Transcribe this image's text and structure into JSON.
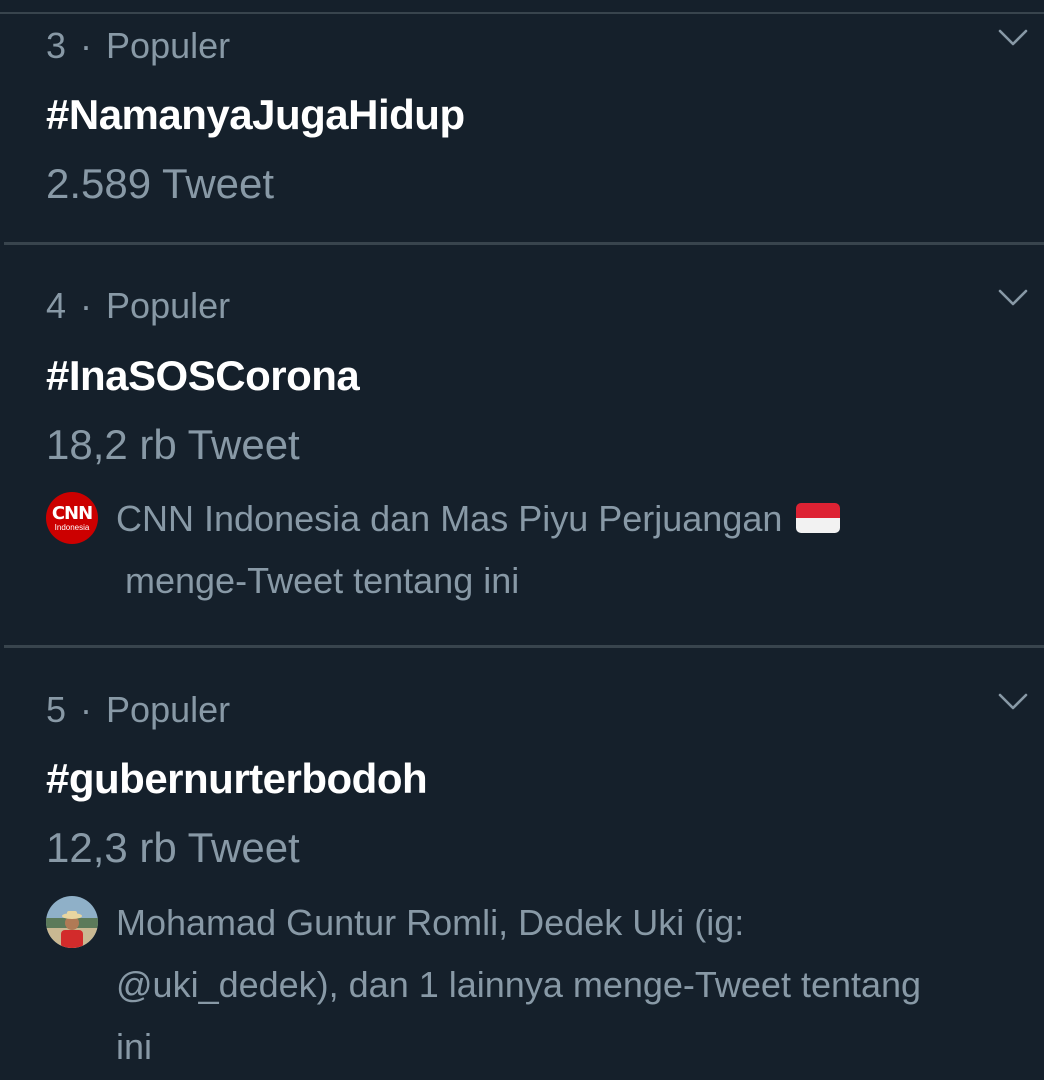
{
  "trends": [
    {
      "rank": "3",
      "separator": "·",
      "category": "Populer",
      "hashtag": "#NamanyaJugaHidup",
      "tweet_count": "2.589 Tweet"
    },
    {
      "rank": "4",
      "separator": "·",
      "category": "Populer",
      "hashtag": "#InaSOSCorona",
      "tweet_count": "18,2 rb Tweet",
      "context": {
        "avatar": "cnn-indonesia-logo",
        "avatar_text": "CNN",
        "avatar_subtext": "Indonesia",
        "line1": "CNN Indonesia dan Mas Piyu Perjuangan",
        "flag": "indonesia-flag-emoji",
        "line2": "menge-Tweet tentang ini"
      }
    },
    {
      "rank": "5",
      "separator": "·",
      "category": "Populer",
      "hashtag": "#gubernurterbodoh",
      "tweet_count": "12,3 rb Tweet",
      "context": {
        "avatar": "user-photo-avatar",
        "line1": "Mohamad Guntur Romli, Dedek Uki (ig:",
        "line2": "@uki_dedek), dan 1 lainnya menge-Tweet tentang",
        "line3": "ini"
      }
    }
  ],
  "icons": {
    "more": "chevron-down-icon"
  },
  "colors": {
    "background": "#15202b",
    "divider": "#38444d",
    "primary_text": "#ffffff",
    "secondary_text": "#8899a6",
    "cnn_red": "#cc0000"
  }
}
